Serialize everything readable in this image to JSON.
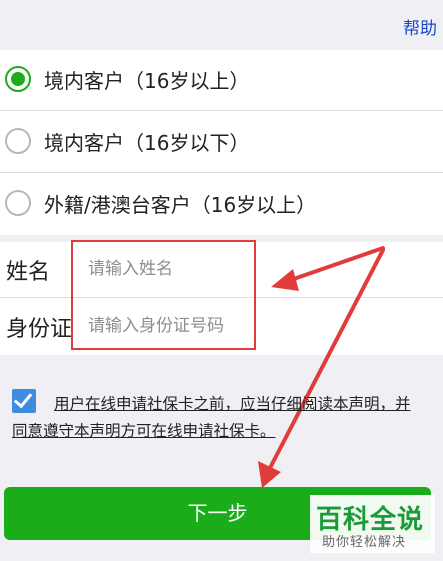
{
  "header": {
    "help_label": "帮助"
  },
  "customer_types": {
    "options": [
      {
        "label": "境内客户（16岁以上）",
        "checked": true
      },
      {
        "label": "境内客户（16岁以下）",
        "checked": false
      },
      {
        "label": "外籍/港澳台客户（16岁以上）",
        "checked": false
      }
    ]
  },
  "form": {
    "name": {
      "label": "姓名",
      "placeholder": "请输入姓名",
      "value": ""
    },
    "id_number": {
      "label": "身份证",
      "placeholder": "请输入身份证号码",
      "value": ""
    }
  },
  "agreement": {
    "checked": true,
    "text": "用户在线申请社保卡之前，应当仔细阅读本声明，并同意遵守本声明方可在线申请社保卡。"
  },
  "next_button": {
    "label": "下一步"
  },
  "watermark": {
    "title": "百科全说",
    "subtitle": "助你轻松解决"
  },
  "colors": {
    "accent_green": "#1aad19",
    "link_blue": "#1a47c9",
    "annotation_red": "#e23b3b",
    "checkbox_blue": "#3d8ce0"
  }
}
